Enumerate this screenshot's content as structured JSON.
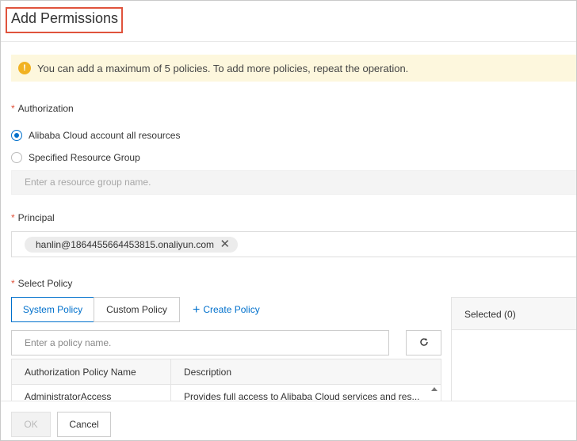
{
  "dialog": {
    "title": "Add Permissions"
  },
  "notice": {
    "icon": "warning-icon",
    "text": "You can add a maximum of 5 policies. To add more policies, repeat the operation."
  },
  "authorization": {
    "required_mark": "*",
    "label": "Authorization",
    "options": [
      {
        "label": "Alibaba Cloud account all resources",
        "checked": true
      },
      {
        "label": "Specified Resource Group",
        "checked": false
      }
    ],
    "resource_group_placeholder": "Enter a resource group name."
  },
  "principal": {
    "required_mark": "*",
    "label": "Principal",
    "tag": "hanlin@1864455664453815.onaliyun.com",
    "tag_close_icon": "close-icon"
  },
  "policy": {
    "required_mark": "*",
    "label": "Select Policy",
    "tabs": [
      {
        "label": "System Policy",
        "active": true
      },
      {
        "label": "Custom Policy",
        "active": false
      }
    ],
    "create_label": "Create Policy",
    "search_placeholder": "Enter a policy name.",
    "refresh_icon": "refresh-icon",
    "table": {
      "columns": [
        "Authorization Policy Name",
        "Description"
      ],
      "rows": [
        {
          "name": "AdministratorAccess",
          "description": "Provides full access to Alibaba Cloud services and res..."
        }
      ]
    },
    "selected_label": "Selected (0)"
  },
  "footer": {
    "ok_label": "OK",
    "cancel_label": "Cancel"
  },
  "colors": {
    "accent": "#0070cc",
    "required": "#e0533c",
    "notice_bg": "#fdf7dd",
    "warning": "#f1b222"
  }
}
